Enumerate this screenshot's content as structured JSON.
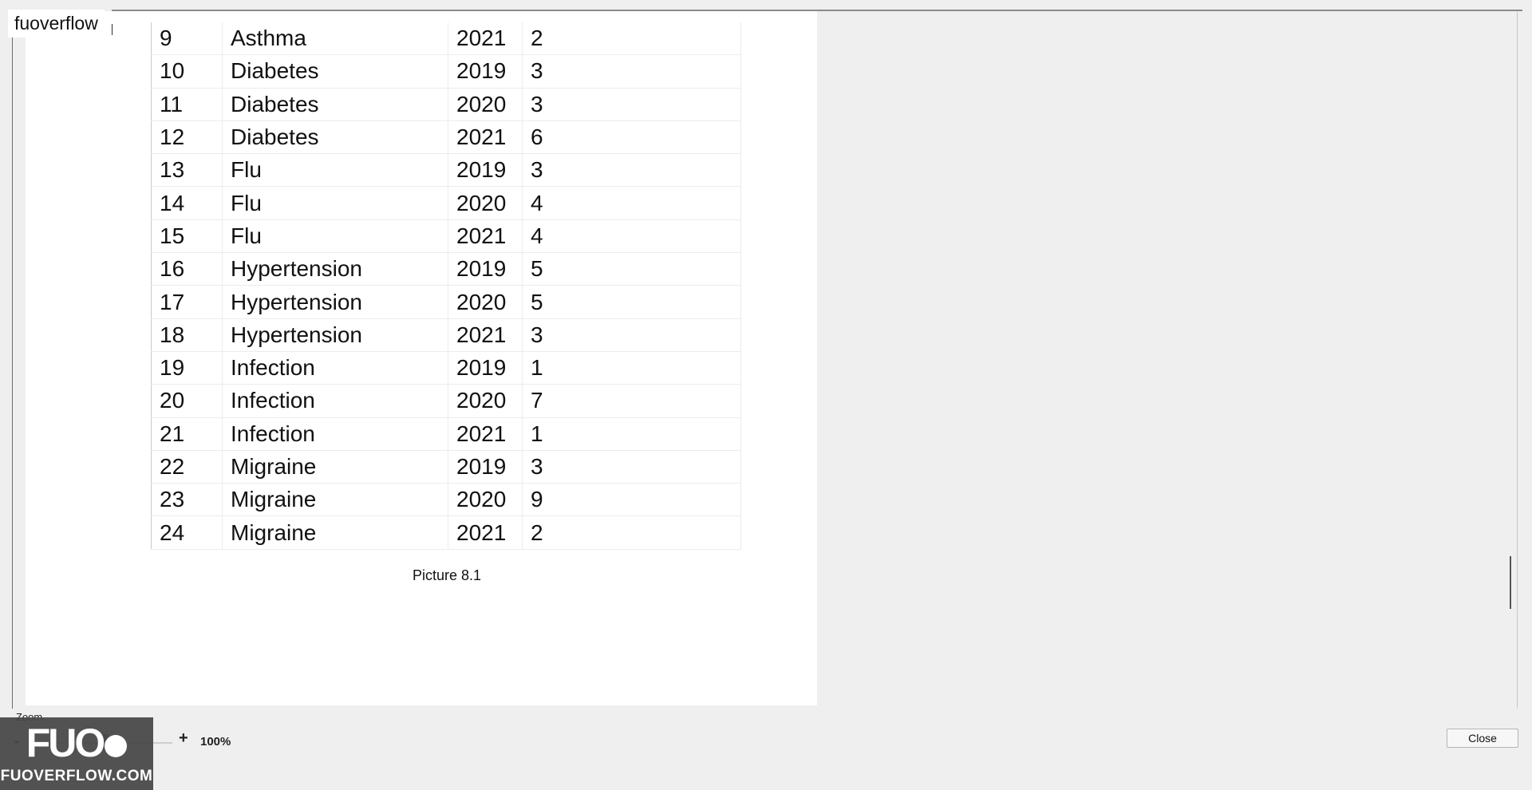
{
  "brand": {
    "label": "fuoverflow"
  },
  "table": {
    "rows": [
      {
        "id": "9",
        "name": "Asthma",
        "year": "2021",
        "count": "2"
      },
      {
        "id": "10",
        "name": "Diabetes",
        "year": "2019",
        "count": "3"
      },
      {
        "id": "11",
        "name": "Diabetes",
        "year": "2020",
        "count": "3"
      },
      {
        "id": "12",
        "name": "Diabetes",
        "year": "2021",
        "count": "6"
      },
      {
        "id": "13",
        "name": "Flu",
        "year": "2019",
        "count": "3"
      },
      {
        "id": "14",
        "name": "Flu",
        "year": "2020",
        "count": "4"
      },
      {
        "id": "15",
        "name": "Flu",
        "year": "2021",
        "count": "4"
      },
      {
        "id": "16",
        "name": "Hypertension",
        "year": "2019",
        "count": "5"
      },
      {
        "id": "17",
        "name": "Hypertension",
        "year": "2020",
        "count": "5"
      },
      {
        "id": "18",
        "name": "Hypertension",
        "year": "2021",
        "count": "3"
      },
      {
        "id": "19",
        "name": "Infection",
        "year": "2019",
        "count": "1"
      },
      {
        "id": "20",
        "name": "Infection",
        "year": "2020",
        "count": "7"
      },
      {
        "id": "21",
        "name": "Infection",
        "year": "2021",
        "count": "1"
      },
      {
        "id": "22",
        "name": "Migraine",
        "year": "2019",
        "count": "3"
      },
      {
        "id": "23",
        "name": "Migraine",
        "year": "2020",
        "count": "9"
      },
      {
        "id": "24",
        "name": "Migraine",
        "year": "2021",
        "count": "2"
      }
    ]
  },
  "caption": "Picture 8.1",
  "zoom": {
    "label": "Zoom",
    "minus_label": "-",
    "plus_label": "+",
    "value": "100%"
  },
  "close_label": "Close",
  "watermark": {
    "logo_text": "FUO",
    "site_text": "FUOVERFLOW.COM"
  }
}
